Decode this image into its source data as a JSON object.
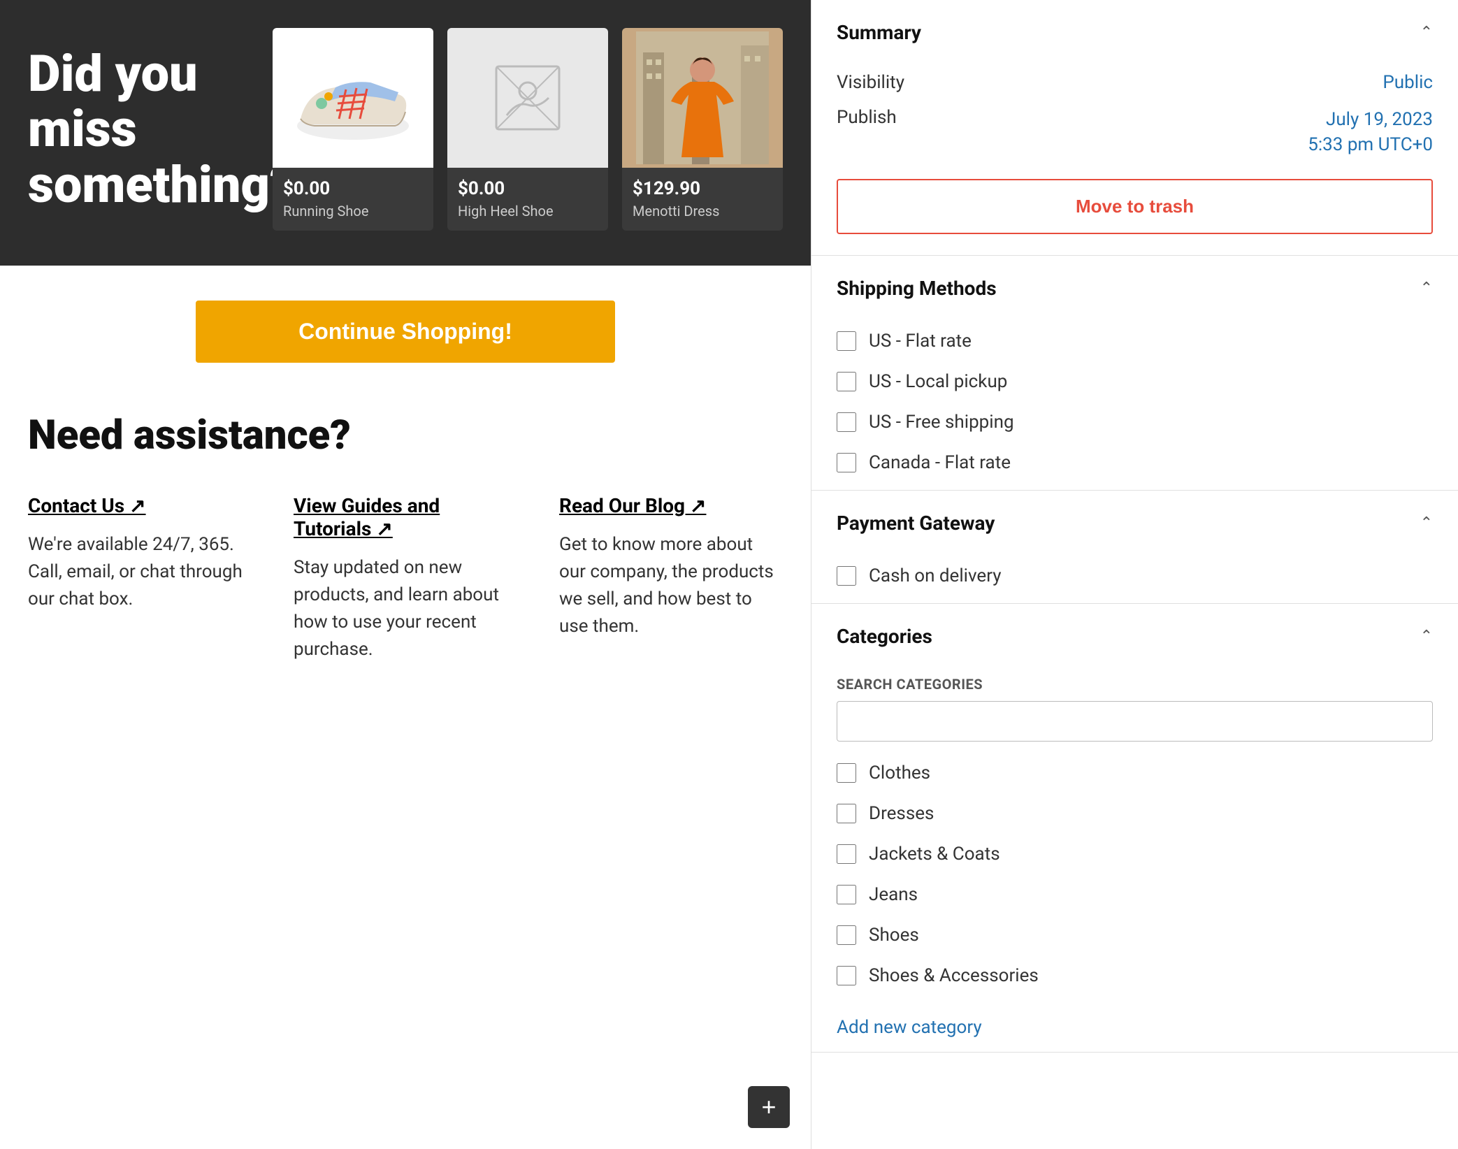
{
  "hero": {
    "heading": "Did you miss something?",
    "products": [
      {
        "price": "$0.00",
        "name": "Running Shoe",
        "imgType": "shoe"
      },
      {
        "price": "$0.00",
        "name": "High Heel Shoe",
        "imgType": "placeholder"
      },
      {
        "price": "$129.90",
        "name": "Menotti Dress",
        "imgType": "dress"
      }
    ]
  },
  "continue_btn": "Continue Shopping!",
  "assistance": {
    "title": "Need assistance?",
    "columns": [
      {
        "link": "Contact Us ↗",
        "text": "We're available 24/7, 365. Call, email, or chat through our chat box."
      },
      {
        "link": "View Guides and Tutorials ↗",
        "text": "Stay updated on new products, and learn about how to use your recent purchase."
      },
      {
        "link": "Read Our Blog ↗",
        "text": "Get to know more about our company, the products we sell, and how best to use them."
      }
    ]
  },
  "summary": {
    "title": "Summary",
    "visibility_label": "Visibility",
    "visibility_value": "Public",
    "publish_label": "Publish",
    "publish_date": "July 19, 2023",
    "publish_time": "5:33 pm UTC+0",
    "move_to_trash": "Move to trash"
  },
  "shipping": {
    "title": "Shipping Methods",
    "methods": [
      {
        "label": "US - Flat rate",
        "checked": false
      },
      {
        "label": "US - Local pickup",
        "checked": false
      },
      {
        "label": "US - Free shipping",
        "checked": false
      },
      {
        "label": "Canada - Flat rate",
        "checked": false
      }
    ]
  },
  "payment": {
    "title": "Payment Gateway",
    "methods": [
      {
        "label": "Cash on delivery",
        "checked": false
      }
    ]
  },
  "categories": {
    "title": "Categories",
    "search_label": "SEARCH CATEGORIES",
    "search_placeholder": "",
    "items": [
      {
        "label": "Clothes",
        "checked": false
      },
      {
        "label": "Dresses",
        "checked": false
      },
      {
        "label": "Jackets & Coats",
        "checked": false
      },
      {
        "label": "Jeans",
        "checked": false
      },
      {
        "label": "Shoes",
        "checked": false
      },
      {
        "label": "Shoes & Accessories",
        "checked": false
      }
    ],
    "add_new": "Add new category"
  },
  "plus_btn": "+"
}
